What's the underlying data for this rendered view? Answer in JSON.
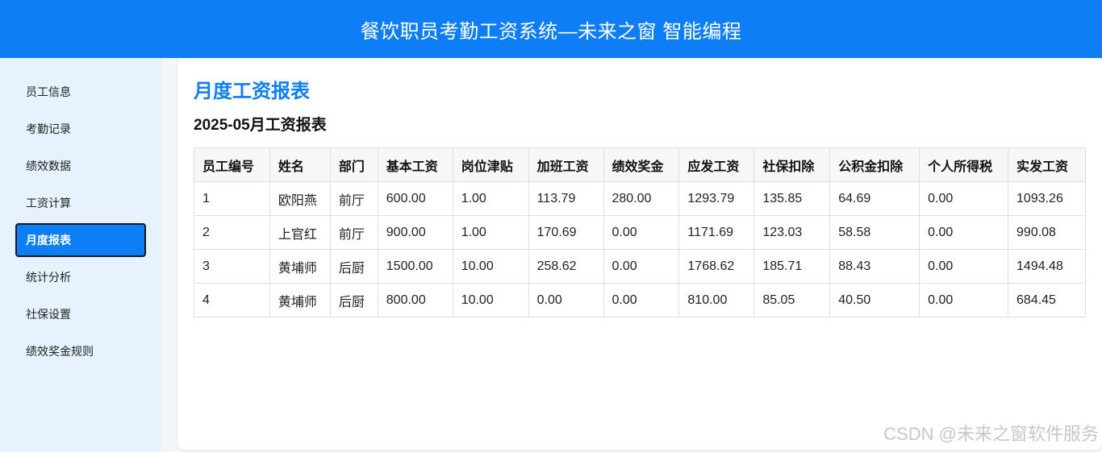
{
  "header": {
    "title": "餐饮职员考勤工资系统—未来之窗 智能编程"
  },
  "sidebar": {
    "items": [
      {
        "label": "员工信息",
        "active": false
      },
      {
        "label": "考勤记录",
        "active": false
      },
      {
        "label": "绩效数据",
        "active": false
      },
      {
        "label": "工资计算",
        "active": false
      },
      {
        "label": "月度报表",
        "active": true
      },
      {
        "label": "统计分析",
        "active": false
      },
      {
        "label": "社保设置",
        "active": false
      },
      {
        "label": "绩效奖金规则",
        "active": false
      }
    ]
  },
  "main": {
    "page_title": "月度工资报表",
    "report_title": "2025-05月工资报表",
    "table": {
      "headers": [
        "员工编号",
        "姓名",
        "部门",
        "基本工资",
        "岗位津贴",
        "加班工资",
        "绩效奖金",
        "应发工资",
        "社保扣除",
        "公积金扣除",
        "个人所得税",
        "实发工资"
      ],
      "rows": [
        [
          "1",
          "欧阳燕",
          "前厅",
          "600.00",
          "1.00",
          "113.79",
          "280.00",
          "1293.79",
          "135.85",
          "64.69",
          "0.00",
          "1093.26"
        ],
        [
          "2",
          "上官红",
          "前厅",
          "900.00",
          "1.00",
          "170.69",
          "0.00",
          "1171.69",
          "123.03",
          "58.58",
          "0.00",
          "990.08"
        ],
        [
          "3",
          "黄埔师",
          "后厨",
          "1500.00",
          "10.00",
          "258.62",
          "0.00",
          "1768.62",
          "185.71",
          "88.43",
          "0.00",
          "1494.48"
        ],
        [
          "4",
          "黄埔师",
          "后厨",
          "800.00",
          "10.00",
          "0.00",
          "0.00",
          "810.00",
          "85.05",
          "40.50",
          "0.00",
          "684.45"
        ]
      ]
    }
  },
  "watermark": "CSDN @未来之窗软件服务",
  "colors": {
    "accent": "#0d7ef5",
    "sidebar_bg": "#e6f3ff",
    "header_bg": "#0d7ef5"
  }
}
